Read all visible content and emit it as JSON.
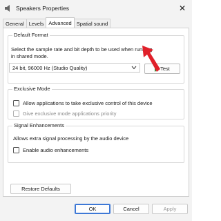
{
  "window": {
    "title": "Speakers Properties",
    "close_glyph": "✕"
  },
  "tabs": [
    {
      "label": "General",
      "active": false
    },
    {
      "label": "Levels",
      "active": false
    },
    {
      "label": "Advanced",
      "active": true
    },
    {
      "label": "Spatial sound",
      "active": false
    }
  ],
  "default_format": {
    "group_title": "Default Format",
    "description_line1": "Select the sample rate and bit depth to be used when running",
    "description_line2": "in shared mode.",
    "selected_format": "24 bit, 96000 Hz (Studio Quality)",
    "test_label": "Test"
  },
  "exclusive_mode": {
    "group_title": "Exclusive Mode",
    "allow_label": "Allow applications to take exclusive control of this device",
    "priority_label": "Give exclusive mode applications priority"
  },
  "signal_enhancements": {
    "group_title": "Signal Enhancements",
    "description": "Allows extra signal processing by the audio device",
    "enable_label": "Enable audio enhancements"
  },
  "buttons": {
    "restore_defaults": "Restore Defaults",
    "ok": "OK",
    "cancel": "Cancel",
    "apply": "Apply"
  },
  "colors": {
    "accent": "#3d78d6",
    "annotation_arrow": "#e0202a",
    "play_icon": "#2a8a2a"
  }
}
